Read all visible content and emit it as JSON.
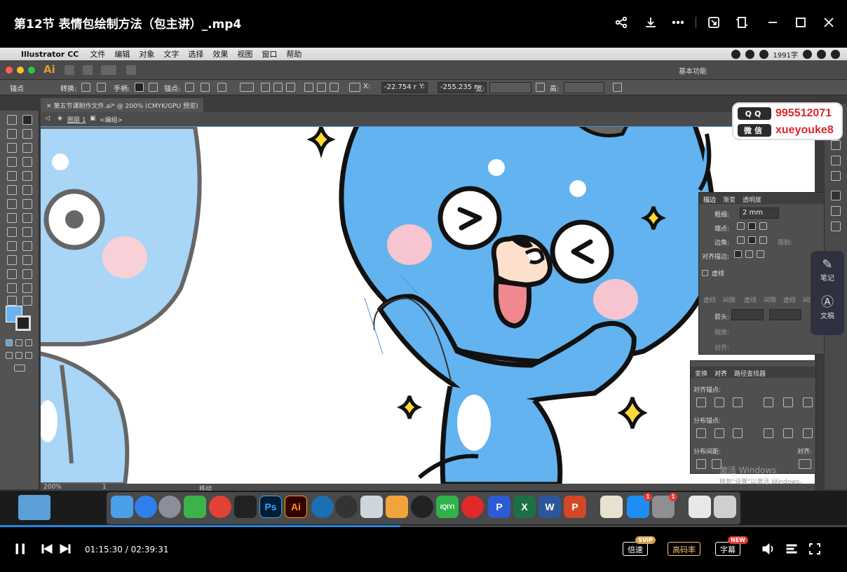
{
  "player": {
    "title": "第12节 表情包绘制方法（包主讲）_.mp4",
    "time_current": "01:15:30",
    "time_total": "02:39:31",
    "time_separator": " / ",
    "progress_fraction": 0.473,
    "speed_label": "倍速",
    "speed_badge": "SVIP",
    "quality_label": "高码率",
    "subtitle_label": "字幕",
    "subtitle_badge": "NEW"
  },
  "mac_menubar": {
    "apple_glyph": "",
    "app_name": "Illustrator CC",
    "menus": [
      "文件",
      "编辑",
      "对象",
      "文字",
      "选择",
      "效果",
      "视图",
      "窗口",
      "帮助"
    ],
    "status_text": "1991字"
  },
  "ai_appbar": {
    "logo": "Ai",
    "workspace": "基本功能"
  },
  "ai_control": {
    "anchor_label": "锚点",
    "convert_label": "转换:",
    "handle_label": "手柄:",
    "anchor2_label": "锚点:",
    "x_label": "X:",
    "x_value": "-22.754 r",
    "y_label": "Y:",
    "y_value": "-255.235 r",
    "w_label": "宽:",
    "h_label": "高:"
  },
  "document": {
    "tab": "第五节课制作文件.ai* @ 200% (CMYK/GPU 预览)",
    "breadcrumb_layer": "图层 1",
    "breadcrumb_group": "<编组>"
  },
  "stroke_panel": {
    "tabs": [
      "描边",
      "渐变",
      "透明度"
    ],
    "weight_label": "粗细:",
    "weight_value": "2 mm",
    "cap_label": "端点:",
    "corner_label": "边角:",
    "limit_label": "限制:",
    "align_label": "对齐描边:",
    "dashed_label": "虚线",
    "dash_labels": [
      "虚线",
      "间隙",
      "虚线",
      "间隙",
      "虚线",
      "间隙"
    ],
    "arrow_label": "箭头:",
    "scale_label": "缩放:",
    "align2_label": "对齐:"
  },
  "align_panel": {
    "tabs": [
      "变换",
      "对齐",
      "路径查找器"
    ],
    "align_objects_label": "对齐锚点:",
    "distribute_objects_label": "分布锚点:",
    "distribute_spacing_label": "分布间距:",
    "align_to_label": "对齐:"
  },
  "statusbar": {
    "zoom": "200%",
    "page": "1",
    "tool": "移动"
  },
  "activate_windows": {
    "title": "激活 Windows",
    "subtitle": "转到\"设置\"以激活 Windows。"
  },
  "contact": {
    "qq_label": "QQ",
    "qq_value": "995512071",
    "wechat_label": "微信",
    "wechat_value": "xueyouke8"
  },
  "side_tools": {
    "notes_label": "笔记",
    "transcript_label": "文稿"
  },
  "dock": {
    "ps_label": "Ps",
    "ai_label": "Ai",
    "iqiyi_label": "iQIYI",
    "word_label": "W",
    "excel_label": "X",
    "ppt_label": "P",
    "wps_label": "P",
    "badge_count": "1"
  },
  "colors": {
    "accent_blue": "#1e88e5",
    "fill_swatch": "#6ab3ee",
    "character_blue": "#62b3ef",
    "light_blue": "#a9d5f7",
    "blush_pink": "#f7c5cf",
    "star_yellow": "#ffd83a",
    "contact_red": "#d9262b"
  }
}
